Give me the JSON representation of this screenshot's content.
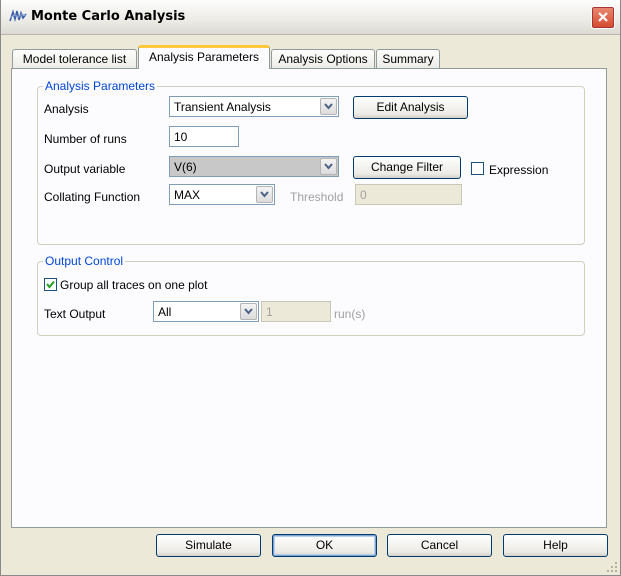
{
  "window": {
    "title": "Monte Carlo Analysis"
  },
  "tabs": [
    {
      "label": "Model tolerance list"
    },
    {
      "label": "Analysis Parameters"
    },
    {
      "label": "Analysis Options"
    },
    {
      "label": "Summary"
    }
  ],
  "analysis_params": {
    "legend": "Analysis Parameters",
    "analysis_label": "Analysis",
    "analysis_value": "Transient Analysis",
    "edit_analysis_label": "Edit Analysis",
    "runs_label": "Number of runs",
    "runs_value": "10",
    "output_var_label": "Output variable",
    "output_var_value": "V(6)",
    "change_filter_label": "Change Filter",
    "expression_label": "Expression",
    "collating_label": "Collating Function",
    "collating_value": "MAX",
    "threshold_label": "Threshold",
    "threshold_value": "0"
  },
  "output_control": {
    "legend": "Output Control",
    "group_traces_label": "Group all traces on one plot",
    "group_traces_checked": true,
    "text_output_label": "Text Output",
    "text_output_value": "All",
    "runs_value": "1",
    "runs_unit": "run(s)"
  },
  "buttons": {
    "simulate": "Simulate",
    "ok": "OK",
    "cancel": "Cancel",
    "help": "Help"
  }
}
